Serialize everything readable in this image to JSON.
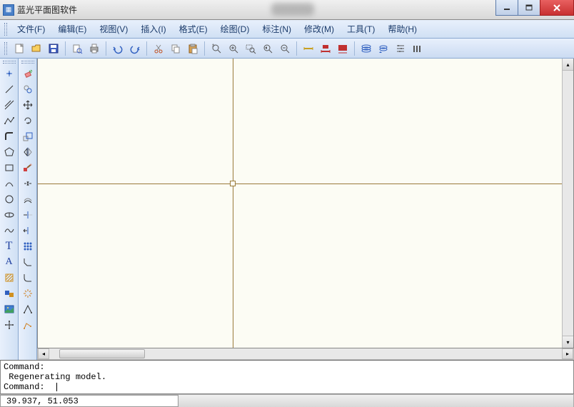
{
  "window": {
    "title": "蓝光平面图软件"
  },
  "menu": {
    "file": "文件(F)",
    "edit": "编辑(E)",
    "view": "视图(V)",
    "insert": "插入(I)",
    "format": "格式(E)",
    "draw": "绘图(D)",
    "annotate": "标注(N)",
    "modify": "修改(M)",
    "tools": "工具(T)",
    "help": "帮助(H)"
  },
  "command_window": {
    "line1": "Command:",
    "line2": " Regenerating model.",
    "line3": "Command:  "
  },
  "status": {
    "coords": "39.937,  51.053"
  }
}
